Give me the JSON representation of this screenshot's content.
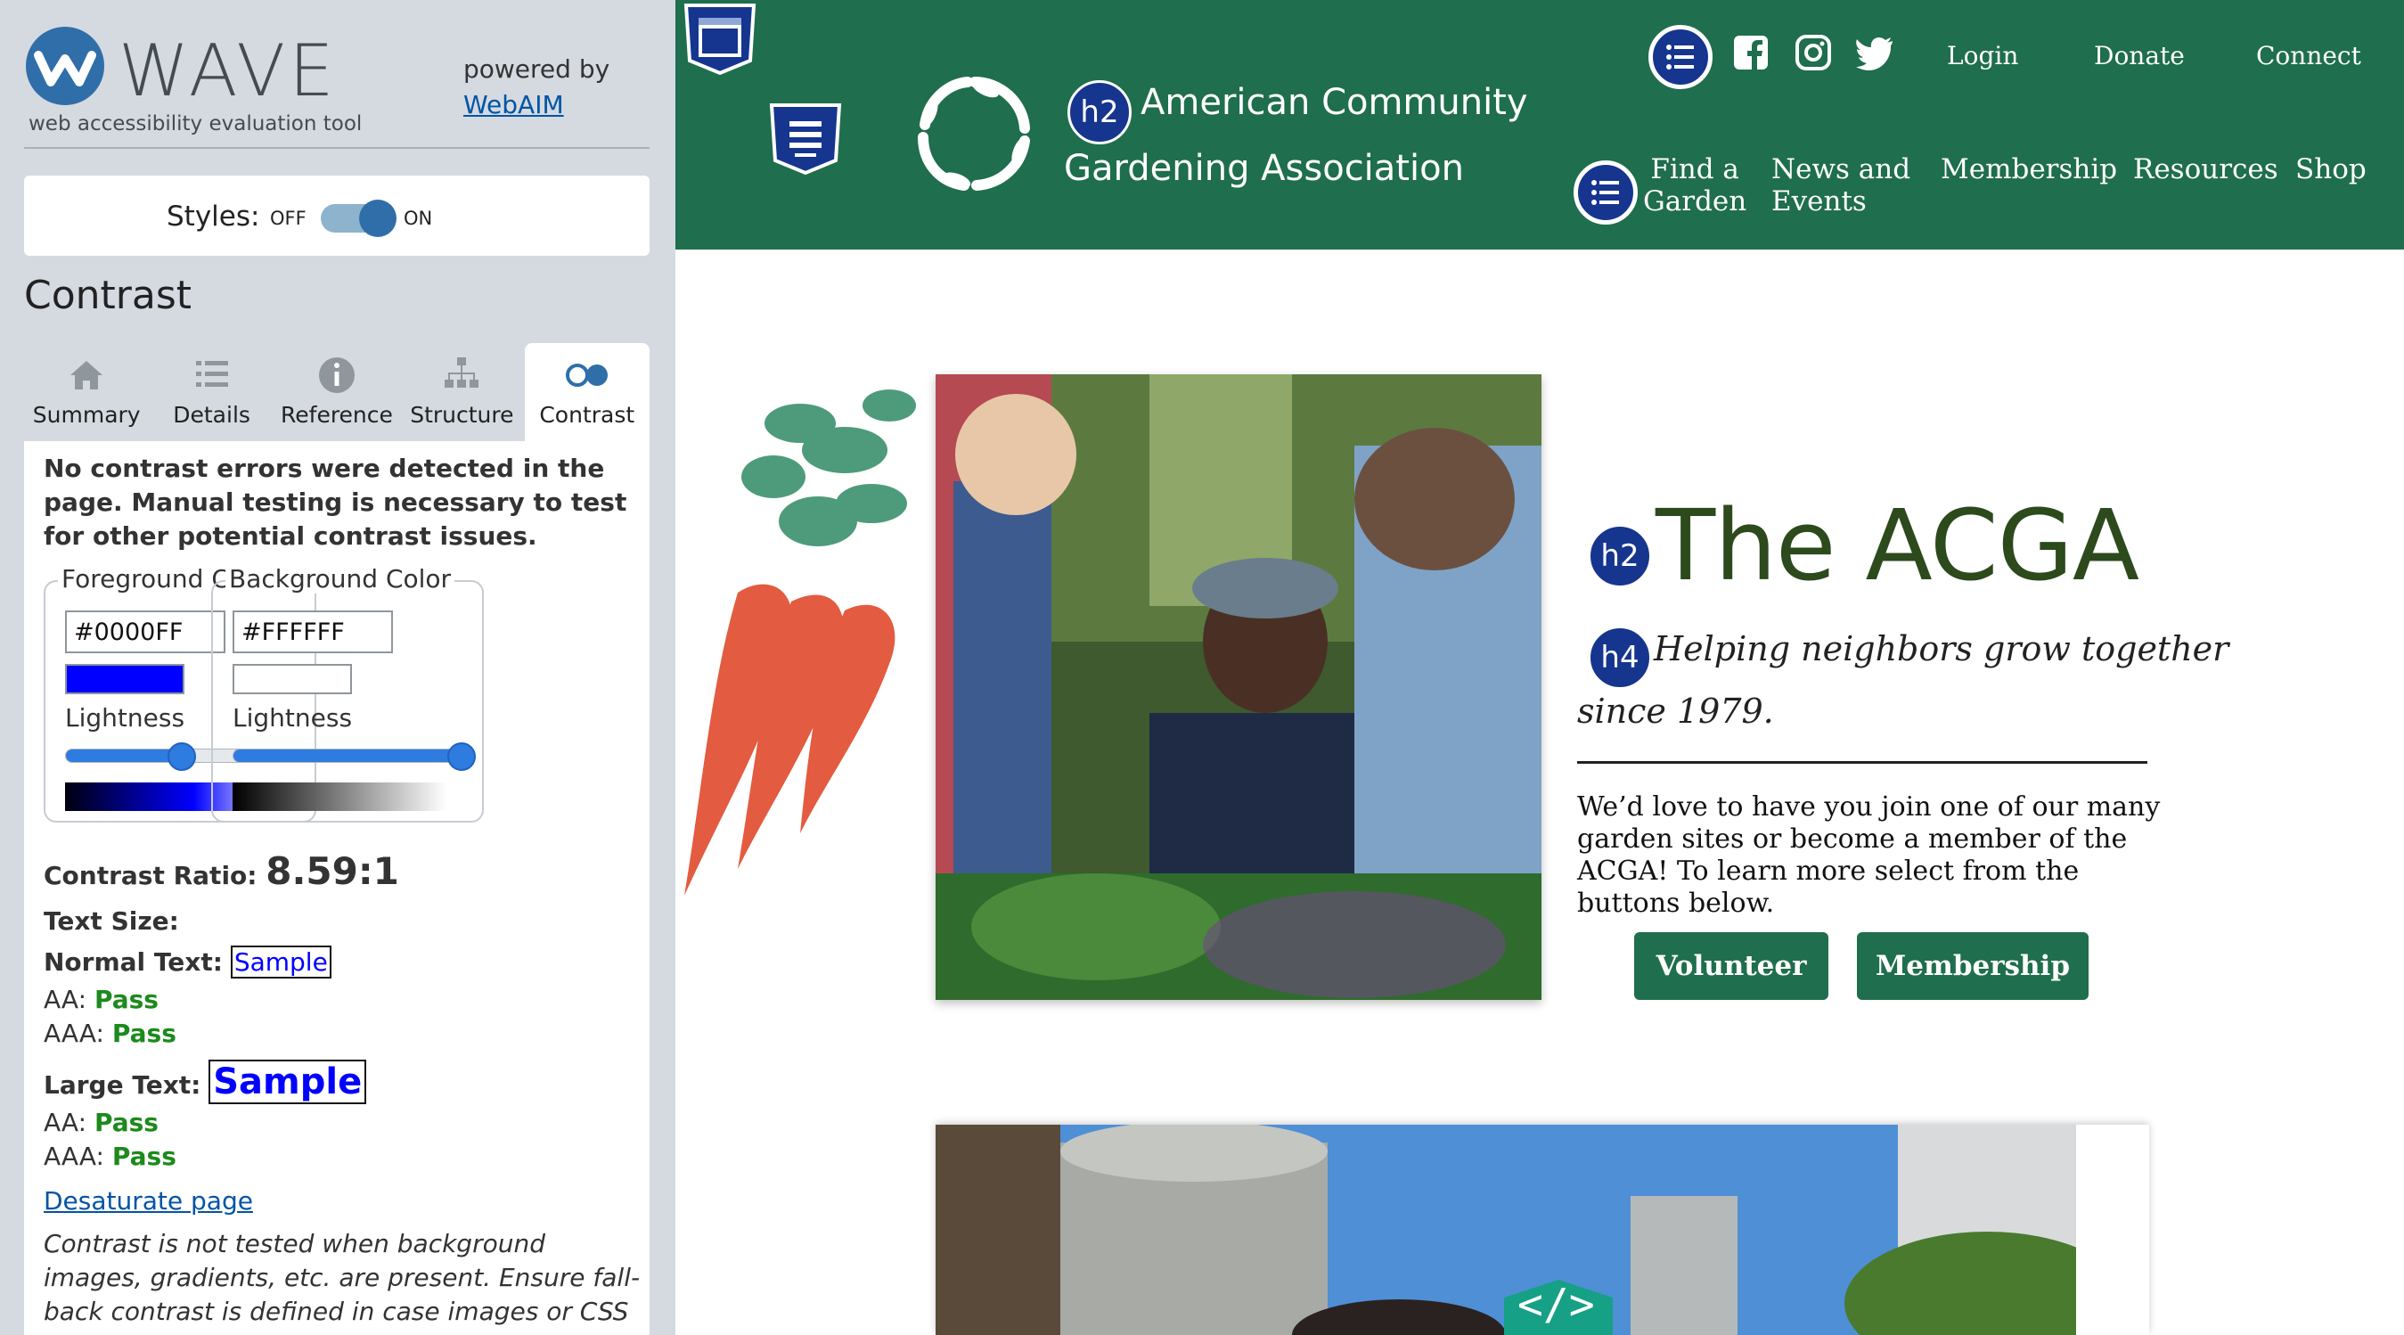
{
  "wave": {
    "name": "WAVE",
    "subtitle": "web accessibility evaluation tool",
    "powered_by": "powered by",
    "webaim_link": "WebAIM",
    "styles_label": "Styles:",
    "toggle_off": "OFF",
    "toggle_on": "ON",
    "panel_title": "Contrast",
    "tabs": [
      {
        "label": "Summary",
        "icon": "home-icon"
      },
      {
        "label": "Details",
        "icon": "list-icon"
      },
      {
        "label": "Reference",
        "icon": "info-icon"
      },
      {
        "label": "Structure",
        "icon": "structure-icon"
      },
      {
        "label": "Contrast",
        "icon": "contrast-icon",
        "active": true
      }
    ],
    "message": "No contrast errors were detected in the page. Manual testing is necessary to test for other potential contrast issues.",
    "foreground": {
      "legend": "Foreground Color",
      "hex": "#0000FF",
      "lightness_label": "Lightness",
      "lightness": 0.5
    },
    "background": {
      "legend": "Background Color",
      "hex": "#FFFFFF",
      "lightness_label": "Lightness",
      "lightness": 0.98
    },
    "contrast_ratio_label": "Contrast Ratio:",
    "contrast_ratio": "8.59:1",
    "text_size_label": "Text Size:",
    "normal_text_label": "Normal Text:",
    "large_text_label": "Large Text:",
    "sample": "Sample",
    "aa_label": "AA:",
    "aaa_label": "AAA:",
    "pass": "Pass",
    "desaturate": "Desaturate page",
    "note": "Contrast is not tested when background images, gradients, etc. are present. Ensure fall-back contrast is defined in case images or CSS do not"
  },
  "site": {
    "org_line1": "American Community",
    "org_line2": "Gardening Association",
    "h2_badge": "h2",
    "h4_badge": "h4",
    "top_nav": [
      "Login",
      "Donate",
      "Connect"
    ],
    "main_nav": [
      {
        "line1": "Find a",
        "line2": "Garden"
      },
      {
        "line1": "News and",
        "line2": "Events"
      },
      {
        "line1": "Membership",
        "line2": ""
      },
      {
        "line1": "Resources",
        "line2": ""
      },
      {
        "line1": "Shop",
        "line2": ""
      }
    ],
    "hero_title": "The ACGA",
    "tagline_1": "Helping neighbors grow together",
    "tagline_2": "since 1979.",
    "intro": "We’d love to have you join one of our many garden sites or become a member of the ACGA! To learn more select from the buttons below.",
    "volunteer_button": "Volunteer",
    "membership_button": "Membership",
    "code_badge": "</>"
  },
  "colors": {
    "header_green": "#1f6e4d",
    "wave_blue": "#16358f",
    "pass_green": "#1c8a1c",
    "link_blue": "#0054a6"
  }
}
